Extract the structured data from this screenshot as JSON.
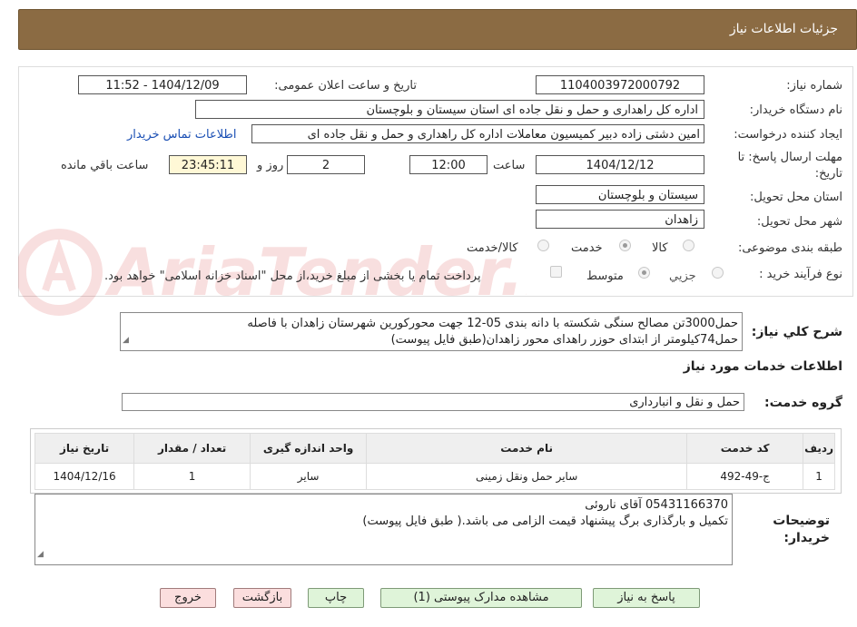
{
  "header": {
    "title": "جزئیات اطلاعات نیاز"
  },
  "fields": {
    "need_number_label": "شماره نیاز:",
    "need_number": "1104003972000792",
    "announce_label": "تاریخ و ساعت اعلان عمومی:",
    "announce_value": "1404/12/09 - 11:52",
    "buyer_org_label": "نام دستگاه خریدار:",
    "buyer_org": "اداره کل راهداری و حمل و نقل جاده ای استان سیستان و بلوچستان",
    "creator_label": "ایجاد کننده درخواست:",
    "creator": "امین دشتی زاده دبیر کمیسیون معاملات اداره کل راهداری و حمل و نقل جاده ای",
    "contact_link": "اطلاعات تماس خریدار",
    "deadline_label_1": "مهلت ارسال پاسخ: تا",
    "deadline_label_2": "تاریخ:",
    "deadline_date": "1404/12/12",
    "time_label": "ساعت",
    "deadline_time": "12:00",
    "days_value": "2",
    "days_label": "روز و",
    "remaining_time": "23:45:11",
    "remaining_label": "ساعت باقي مانده",
    "province_label": "استان محل تحویل:",
    "province": "سیستان و بلوچستان",
    "city_label": "شهر محل تحویل:",
    "city": "زاهدان",
    "category_label": "طبقه بندی موضوعی:",
    "category_options": [
      "کالا",
      "خدمت",
      "کالا/خدمت"
    ],
    "category_selected": "خدمت",
    "process_label": "نوع فرآیند خرید :",
    "process_options": [
      "جزیي",
      "متوسط"
    ],
    "process_selected": "متوسط",
    "payment_note": "پرداخت تمام یا بخشی از مبلغ خرید،از محل \"اسناد خزانه اسلامی\" خواهد بود."
  },
  "description": {
    "label": "شرح كلي نیاز:",
    "text_line1": "حمل3000تن مصالح سنگی شکسته با دانه بندی 05-12 جهت محورکورین شهرستان زاهدان با فاصله",
    "text_line2": "حمل74کیلومتر از ابتدای حوزر راهدای محور زاهدان(طبق فایل پیوست)"
  },
  "services": {
    "section_title": "اطلاعات خدمات مورد نیاز",
    "group_label": "گروه خدمت:",
    "group_value": "حمل و نقل و انبارداری",
    "columns": [
      "ردیف",
      "کد خدمت",
      "نام خدمت",
      "واحد اندازه گیری",
      "تعداد / مقدار",
      "تاریخ نیاز"
    ],
    "rows": [
      {
        "row": "1",
        "code": "ج-49-492",
        "name": "سایر حمل ونقل زمینی",
        "unit": "سایر",
        "qty": "1",
        "date": "1404/12/16"
      }
    ]
  },
  "buyer_notes": {
    "label_1": "توضیحات",
    "label_2": "خریدار:",
    "line1": "05431166370 آقای ناروئی",
    "line2": "تکمیل و بارگذاری برگ پیشنهاد قیمت الزامی می باشد.( طبق فایل پیوست)"
  },
  "buttons": {
    "reply": "پاسخ به نیاز",
    "docs": "مشاهده مدارک پیوستی (1)",
    "print": "چاپ",
    "back": "بازگشت",
    "exit": "خروج"
  },
  "watermark": {
    "text": "AriaTender.neT"
  },
  "colors": {
    "header_bg": "#8b6b43",
    "button_green": "#dff4d9",
    "button_pink": "#fbdede",
    "link": "#1a4fb4"
  }
}
